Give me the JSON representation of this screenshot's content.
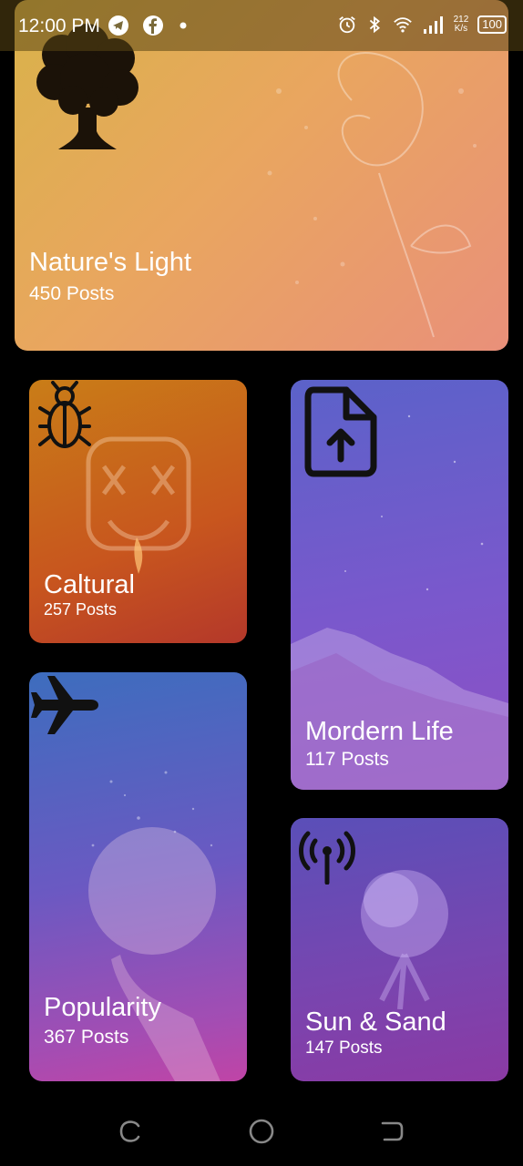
{
  "status_bar": {
    "time": "12:00 PM",
    "net_speed_value": "212",
    "net_speed_unit": "K/s",
    "battery": "100",
    "icons": [
      "telegram-icon",
      "facebook-icon",
      "dot-icon",
      "alarm-icon",
      "bluetooth-icon",
      "wifi-icon",
      "signal-icon",
      "battery-icon"
    ]
  },
  "cards": [
    {
      "id": "nature",
      "title": "Nature's Light",
      "count": "450 Posts",
      "icon": "tree-icon"
    },
    {
      "id": "cultural",
      "title": "Caltural",
      "count": "257 Posts",
      "icon": "bug-icon"
    },
    {
      "id": "modern",
      "title": "Mordern Life",
      "count": "117 Posts",
      "icon": "file-upload-icon"
    },
    {
      "id": "popularity",
      "title": "Popularity",
      "count": "367 Posts",
      "icon": "airplane-icon"
    },
    {
      "id": "sun",
      "title": "Sun & Sand",
      "count": "147 Posts",
      "icon": "antenna-icon"
    }
  ],
  "nav_bar": {
    "icons": [
      "recents-icon",
      "home-icon",
      "back-icon"
    ]
  },
  "colors": {
    "background": "#000000",
    "text": "#ffffff",
    "icon": "#111111"
  }
}
